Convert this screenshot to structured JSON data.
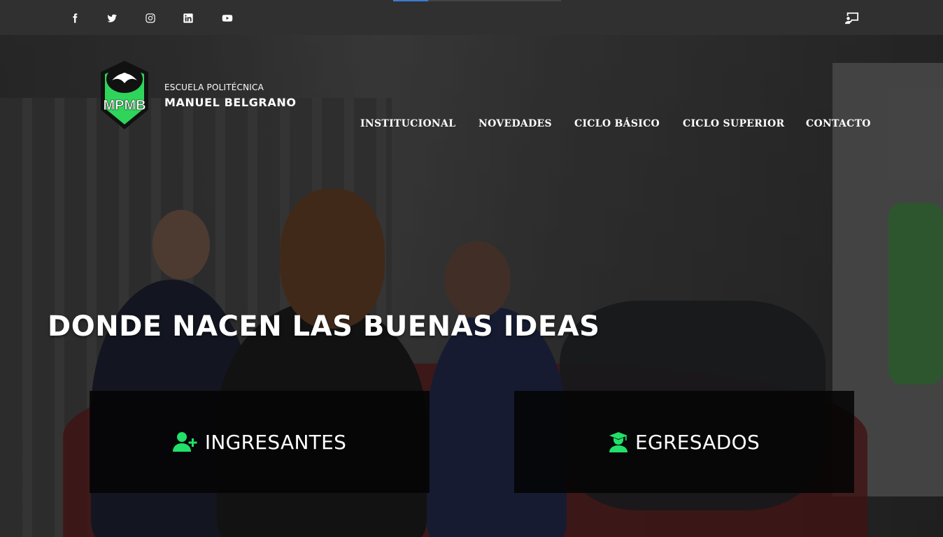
{
  "topbar": {
    "social": [
      {
        "name": "facebook-icon"
      },
      {
        "name": "twitter-icon"
      },
      {
        "name": "instagram-icon"
      },
      {
        "name": "linkedin-icon"
      },
      {
        "name": "youtube-icon"
      }
    ],
    "login_icon": "login-icon"
  },
  "brand": {
    "line1": "ESCUELA POLITÉCNICA",
    "line2": "MANUEL BELGRANO",
    "logo_monogram": "MPMB"
  },
  "nav": {
    "items": [
      {
        "label": "INSTITUCIONAL"
      },
      {
        "label": "NOVEDADES"
      },
      {
        "label": "CICLO BÁSICO"
      },
      {
        "label": "CICLO SUPERIOR"
      },
      {
        "label": "CONTACTO"
      }
    ]
  },
  "hero": {
    "title": "DONDE NACEN LAS BUENAS IDEAS"
  },
  "cta": [
    {
      "label": "INGRESANTES",
      "icon": "user-plus-icon"
    },
    {
      "label": "EGRESADOS",
      "icon": "graduate-icon"
    }
  ],
  "colors": {
    "accent": "#22e06a",
    "topbar": "#303030",
    "cta_bg": "#050505"
  }
}
